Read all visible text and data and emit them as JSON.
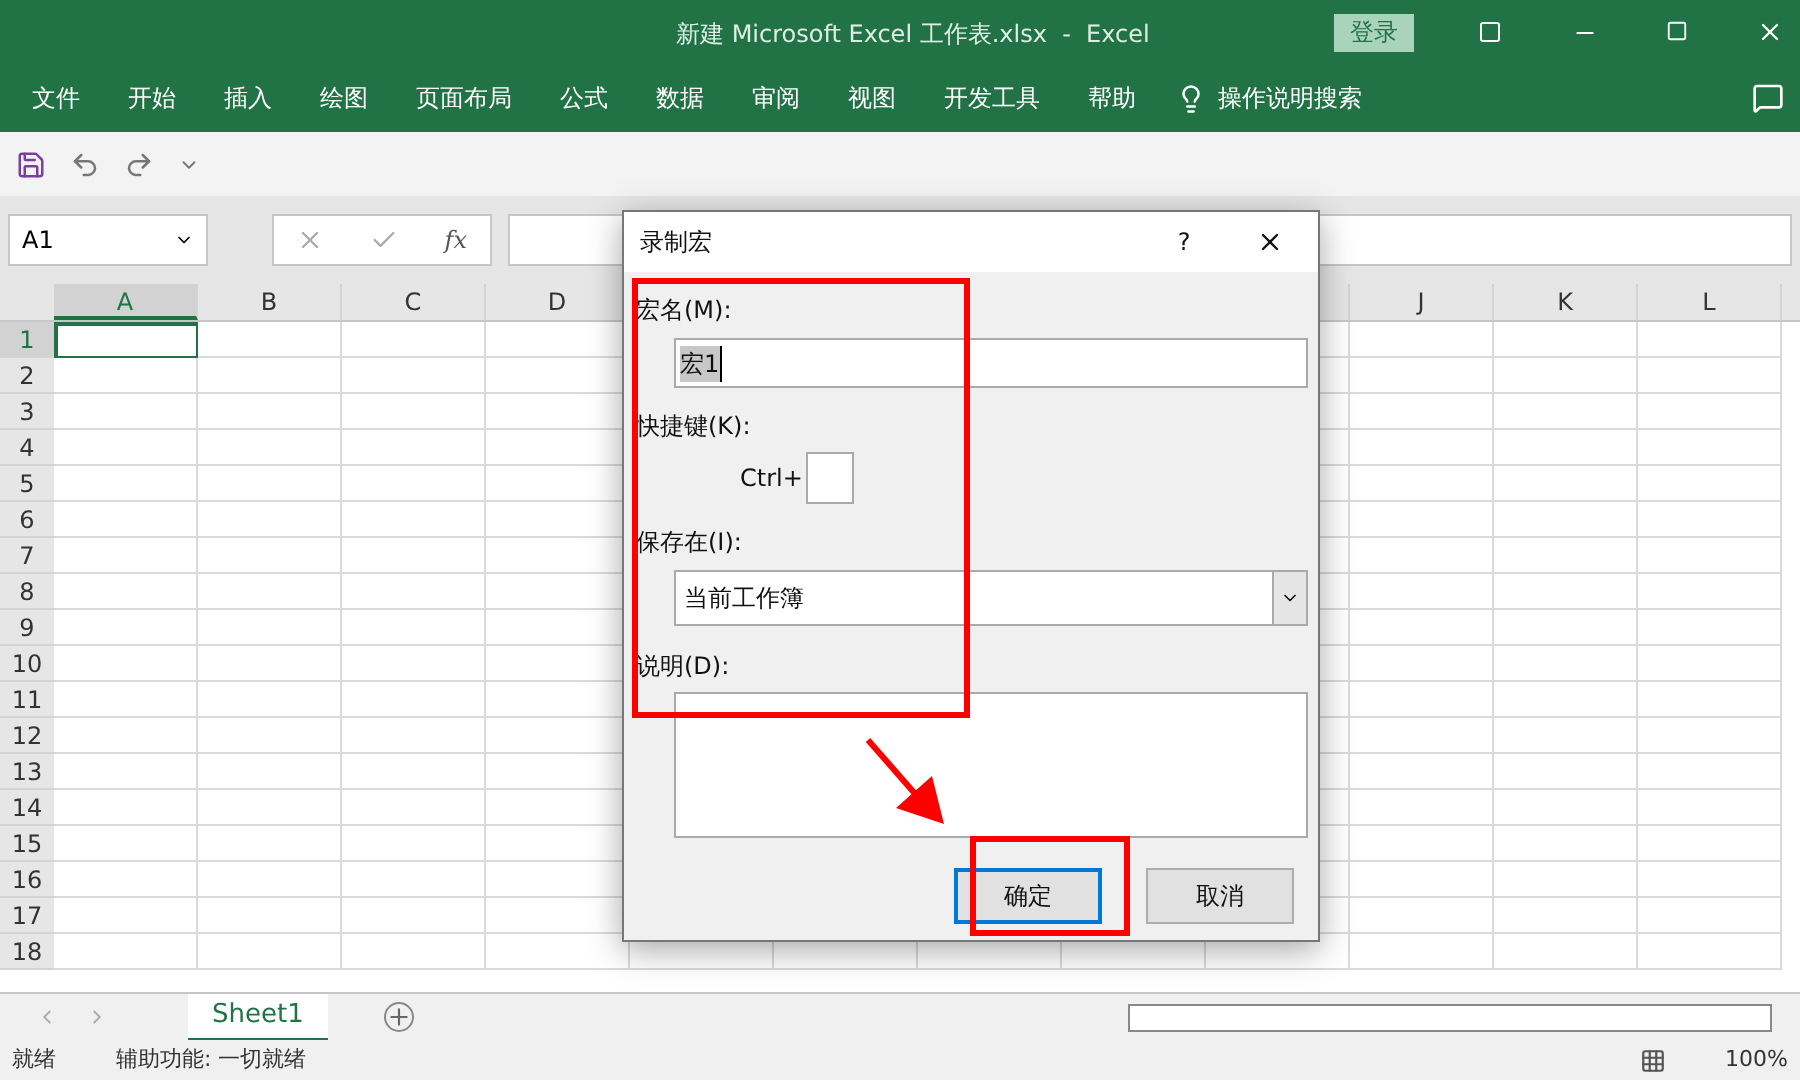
{
  "window": {
    "title": "新建 Microsoft Excel 工作表.xlsx  -  Excel",
    "login": "登录"
  },
  "ribbon_tabs": [
    "文件",
    "开始",
    "插入",
    "绘图",
    "页面布局",
    "公式",
    "数据",
    "审阅",
    "视图",
    "开发工具",
    "帮助"
  ],
  "tell_me": "操作说明搜索",
  "name_box": "A1",
  "function_button": "fx",
  "columns": [
    {
      "label": "A",
      "selected": true
    },
    {
      "label": "B",
      "selected": false
    },
    {
      "label": "C",
      "selected": false
    },
    {
      "label": "D",
      "selected": false
    },
    {
      "label": "J",
      "selected": false
    },
    {
      "label": "K",
      "selected": false
    },
    {
      "label": "L",
      "selected": false
    }
  ],
  "rows": [
    {
      "label": "1",
      "selected": true
    },
    {
      "label": "2",
      "selected": false
    },
    {
      "label": "3",
      "selected": false
    },
    {
      "label": "4",
      "selected": false
    },
    {
      "label": "5",
      "selected": false
    },
    {
      "label": "6",
      "selected": false
    },
    {
      "label": "7",
      "selected": false
    },
    {
      "label": "8",
      "selected": false
    },
    {
      "label": "9",
      "selected": false
    },
    {
      "label": "10",
      "selected": false
    },
    {
      "label": "11",
      "selected": false
    },
    {
      "label": "12",
      "selected": false
    },
    {
      "label": "13",
      "selected": false
    },
    {
      "label": "14",
      "selected": false
    },
    {
      "label": "15",
      "selected": false
    },
    {
      "label": "16",
      "selected": false
    },
    {
      "label": "17",
      "selected": false
    },
    {
      "label": "18",
      "selected": false
    }
  ],
  "sheet_tabs": [
    {
      "label": "Sheet1",
      "selected": true
    }
  ],
  "status_bar": {
    "ready": "就绪",
    "accessibility": "辅助功能: 一切就绪",
    "zoom": "100%"
  },
  "dialog": {
    "title": "录制宏",
    "help": "?",
    "macro_name": {
      "label": "宏名(M):",
      "value": "宏1"
    },
    "shortcut": {
      "label": "快捷键(K):",
      "prefix": "Ctrl+"
    },
    "store_in": {
      "label": "保存在(I):",
      "value": "当前工作簿"
    },
    "description": {
      "label": "说明(D):"
    },
    "buttons": [
      {
        "label": "确定",
        "default": true
      },
      {
        "label": "取消",
        "default": false
      }
    ]
  }
}
